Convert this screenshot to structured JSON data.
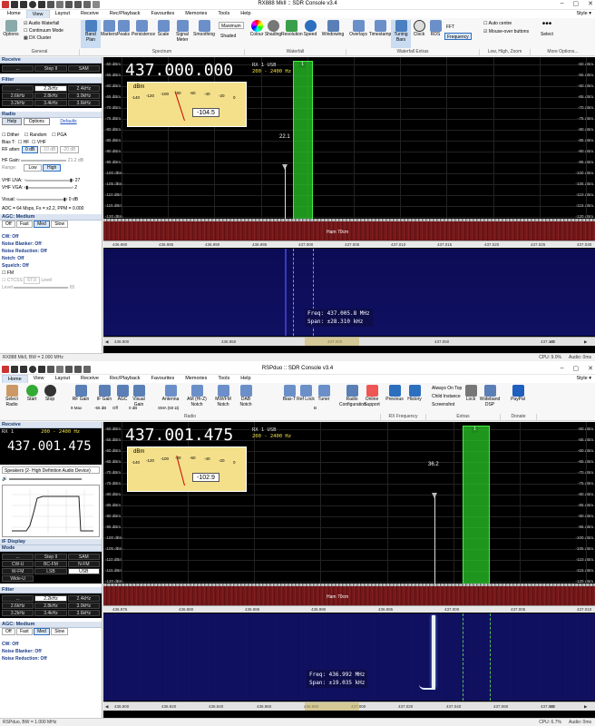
{
  "windows": [
    {
      "title": "RX888 MkII :: SDR Console v3.4",
      "menu": [
        "Home",
        "View",
        "Layout",
        "Receive",
        "Rec/Playback",
        "Favourites",
        "Memories",
        "Tools",
        "Help"
      ],
      "active_menu": "View",
      "style_label": "Style",
      "ribbon": {
        "general": {
          "label": "General",
          "items": [
            "Options",
            "Audio Waterfall",
            "Continuum Mode",
            "DX Cluster"
          ]
        },
        "spectrum": {
          "label": "Spectrum",
          "items": [
            "Band Plan",
            "Markers",
            "Peaks",
            "Persistence",
            "Scale",
            "Signal Meter",
            "Smoothing",
            "Maximum",
            "Shaded"
          ]
        },
        "waterfall": {
          "label": "Waterfall",
          "items": [
            "Colour",
            "Shading",
            "Resolution",
            "Speed",
            "Windowing"
          ]
        },
        "extras": {
          "label": "Waterfall Extras",
          "items": [
            "Overlays",
            "Timestamp",
            "Tuning Bars",
            "Clock",
            "RDS",
            "FFT",
            "Frequency"
          ]
        },
        "zoom": {
          "label": "Low, High, Zoom",
          "items": [
            "Auto centre",
            "Mouse-over buttons"
          ]
        },
        "more": {
          "label": "More Options...",
          "items": [
            "Select"
          ]
        }
      },
      "left": {
        "receive_label": "Receive",
        "modes": [
          "...",
          "Step II",
          "SAM"
        ],
        "filter_label": "Filter",
        "filters": [
          "...",
          "2.2kHz",
          "2.4kHz",
          "2.6kHz",
          "2.8kHz",
          "3.0kHz",
          "3.2kHz",
          "3.4kHz",
          "3.6kHz"
        ],
        "radio_label": "Radio",
        "radio_tabs": [
          "Help",
          "Options",
          "Defaults"
        ],
        "checks": [
          "Dither",
          "Random",
          "PGA"
        ],
        "bias_t": "Bias T:",
        "hf": "HF",
        "vhf": "VHF",
        "rf_atten": "RF atten:",
        "rf_vals": [
          "0 dB",
          "-10 dB",
          "-20 dB"
        ],
        "if_gain": "HF Gain:",
        "if_gain_val": "21.2 dB",
        "range": "Range:",
        "low": "Low",
        "high": "High",
        "vhf_lna": "VHF LNA:",
        "vhf_lna_val": "27",
        "vhf_vga": "VHF VGA:",
        "vhf_vga_val": "2",
        "visual": "Visual:",
        "visual_val": "0 dB",
        "adc": "ADC = 64 Msps, Fs = x2.2, PPM = 0.000",
        "agc": "AGC: Medium",
        "agc_btns": [
          "Off",
          "Fast",
          "Med",
          "Slow"
        ],
        "cw": "CW: Off",
        "nb": "Noise Blanker: Off",
        "nr": "Noise Reduction: Off",
        "notch": "Notch: Off",
        "squelch": "Squelch: Off",
        "fm": "FM",
        "ctcss": "CTCSS",
        "ctcss_val": "67.0",
        "level": "Level",
        "level_val": "65"
      },
      "frequency": "437.000.000",
      "rx_label": "RX 1  USB",
      "rx_band": "200 - 2400 Hz",
      "smeter": {
        "unit": "dBm",
        "value": "-104.5",
        "scale": [
          "-140",
          "-120",
          "-100",
          "-80",
          "-60",
          "-40",
          "-20",
          "0"
        ]
      },
      "y_axis": [
        "-50 dBm",
        "-55 dBm",
        "-60 dBm",
        "-65 dBm",
        "-70 dBm",
        "-75 dBm",
        "-80 dBm",
        "-85 dBm",
        "-90 dBm",
        "-95 dBm",
        "-100 dBm",
        "-105 dBm",
        "-110 dBm",
        "-115 dBm",
        "-120 dBm"
      ],
      "peak_label": "22.1",
      "band_label": "Ham 70cm",
      "x_axis": [
        "436.980",
        "436.985",
        "436.990",
        "436.995",
        "437.000",
        "437.005",
        "437.010",
        "437.015",
        "437.020",
        "437.025",
        "437.030"
      ],
      "wf_freq": "Freq: 437.005.8 MHz",
      "wf_span": "Span:  ±28.310 kHz",
      "bottom_axis": [
        "436.900",
        "436.950",
        "437.000",
        "437.050",
        "437.100"
      ],
      "bottom_zoom": "x5",
      "status_left": "RX888 MkII, BW = 2.000 MHz",
      "status_cpu": "CPU: 9.0%",
      "status_audio": "Audio: 0ms"
    },
    {
      "title": "RSPduo :: SDR Console v3.4",
      "menu": [
        "Home",
        "View",
        "Layout",
        "Receive",
        "Rec/Playback",
        "Favourites",
        "Memories",
        "Tools",
        "Help"
      ],
      "active_menu": "Home",
      "style_label": "Style",
      "ribbon": {
        "items": [
          "Select Radio",
          "Start",
          "Stop",
          "RF Gain",
          "IF Gain",
          "AGC",
          "Visual Gain",
          "Antenna",
          "AM (Hi-Z) Notch",
          "MW/FM Notch",
          "DAB Notch",
          "Bias-T",
          "Ref Lock",
          "Tuner",
          "Radio Configuration",
          "Online Support",
          "Previous",
          "History",
          "Always On Top",
          "Child Instance",
          "Screenshot",
          "Lock",
          "Wideband DSP",
          "PayPal"
        ],
        "rf_gain_val": "9 Max",
        "if_gain_val": "-55 dB",
        "agc_val": "Off",
        "visual_gain_val": "0 dB",
        "antenna_val": "SMA (50 Ω)",
        "tuner_val": "B",
        "groups": [
          "Radio",
          "RX Frequency",
          "Extras",
          "Donate"
        ]
      },
      "left": {
        "receive_label": "Receive",
        "rx_label": "RX 1",
        "rx_band": "200 - 2400 Hz",
        "frequency": "437.001.475",
        "audio_device": "Speakers (2- High Definition Audio Device)",
        "if_display": "IF Display",
        "mode_label": "Mode",
        "modes": [
          "...",
          "Step II",
          "SAM",
          "CW-U",
          "BC-FM",
          "N-FM",
          "W-FM",
          "LSB",
          "USB",
          "Wide-U"
        ],
        "filter_label": "Filter",
        "filters": [
          "...",
          "2.2kHz",
          "2.4kHz",
          "2.6kHz",
          "2.8kHz",
          "3.0kHz",
          "3.2kHz",
          "3.4kHz",
          "3.6kHz"
        ],
        "agc": "AGC: Medium",
        "agc_btns": [
          "Off",
          "Fast",
          "Med",
          "Slow"
        ],
        "cw": "CW: Off",
        "nb": "Noise Blanker: Off",
        "nr": "Noise Reduction: Off"
      },
      "frequency": "437.001.475",
      "rx_label": "RX 1  USB",
      "rx_band": "200 - 2400 Hz",
      "smeter": {
        "unit": "dBm",
        "value": "-102.9",
        "scale": [
          "-140",
          "-120",
          "-100",
          "-80",
          "-60",
          "-40",
          "-20",
          "0"
        ]
      },
      "y_axis": [
        "-50 dBm",
        "-55 dBm",
        "-60 dBm",
        "-65 dBm",
        "-70 dBm",
        "-75 dBm",
        "-80 dBm",
        "-85 dBm",
        "-90 dBm",
        "-95 dBm",
        "-100 dBm",
        "-105 dBm",
        "-110 dBm",
        "-115 dBm",
        "-120 dBm"
      ],
      "peak_label": "36.2",
      "band_label": "Ham 70cm",
      "x_axis": [
        "436.975",
        "436.980",
        "436.985",
        "436.990",
        "436.995",
        "437.000",
        "437.005",
        "437.010"
      ],
      "wf_freq": "Freq: 436.992 MHz",
      "wf_span": "Span:  ±19.035 kHz",
      "bottom_axis": [
        "436.900",
        "436.920",
        "436.940",
        "436.960",
        "436.980",
        "437.000",
        "437.020",
        "437.040",
        "437.060",
        "437.080"
      ],
      "bottom_zoom": "x5",
      "status_left": "RSPduo, BW = 1.000 MHz",
      "status_cpu": "CPU: 6.7%",
      "status_audio": "Audio: 0ms"
    }
  ],
  "colors": {
    "accent": "#2c6fbf",
    "panel": "#dbe4f0",
    "green": "#22cc22",
    "noise": "#7a1a1c",
    "wf": "#0d0d4a"
  }
}
